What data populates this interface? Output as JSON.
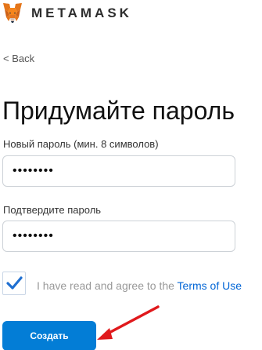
{
  "header": {
    "logo_icon": "metamask-fox-icon",
    "brand": "METAMASK"
  },
  "nav": {
    "back_label": "< Back"
  },
  "main": {
    "title": "Придумайте пароль",
    "new_password": {
      "label": "Новый пароль (мин. 8 символов)",
      "value": "••••••••"
    },
    "confirm_password": {
      "label": "Подтвердите пароль",
      "value": "••••••••"
    },
    "terms": {
      "checked": true,
      "text": "I have read and agree to the ",
      "link_text": "Terms of Use"
    },
    "create_button_label": "Создать"
  },
  "annotation": {
    "icon": "red-arrow-icon",
    "color": "#e0191c"
  },
  "colors": {
    "accent": "#037dd6",
    "link": "#0366d6",
    "check": "#1f6fd1"
  }
}
